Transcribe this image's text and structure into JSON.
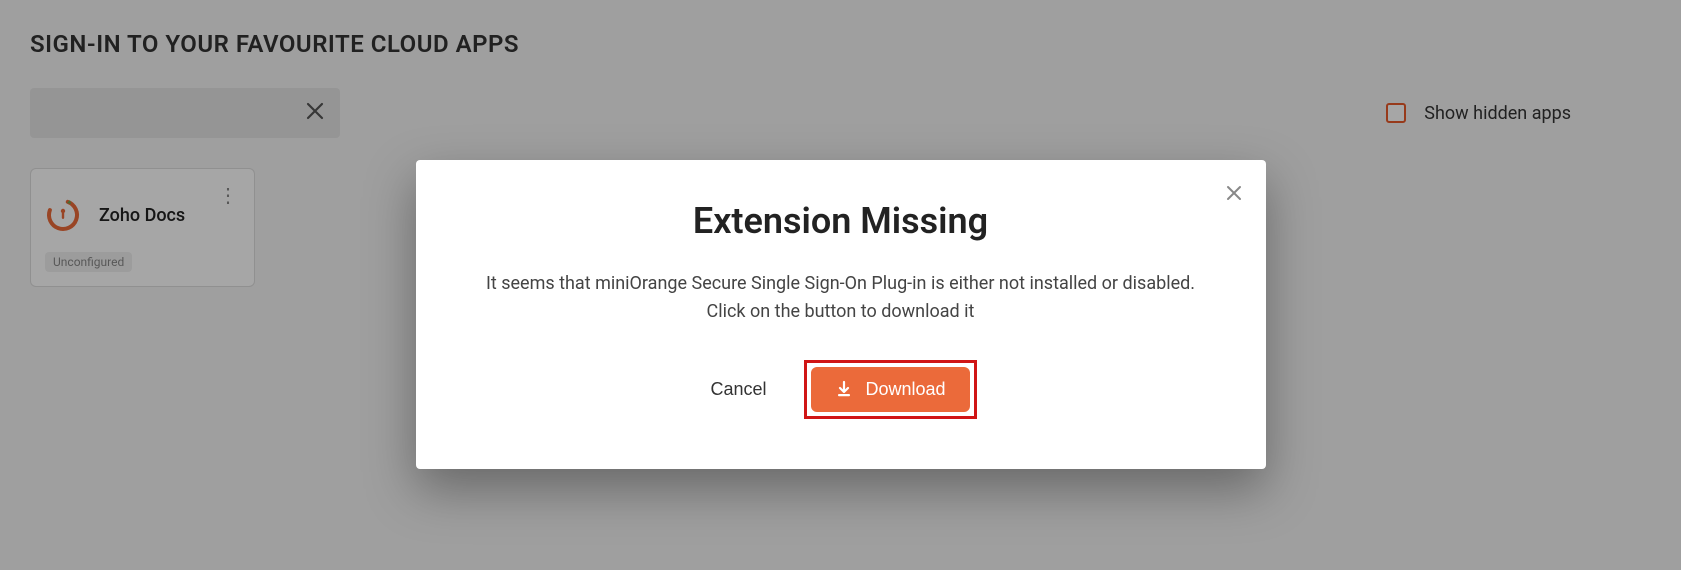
{
  "header": {
    "title": "SIGN-IN TO YOUR FAVOURITE CLOUD APPS"
  },
  "toolbar": {
    "search_value": "",
    "search_placeholder": "",
    "show_hidden_label": "Show hidden apps",
    "show_hidden_checked": false
  },
  "apps": [
    {
      "name": "Zoho Docs",
      "status": "Unconfigured"
    }
  ],
  "modal": {
    "title": "Extension Missing",
    "body_line1": "It seems that miniOrange Secure Single Sign-On Plug-in is either not installed or disabled.",
    "body_line2": "Click on the button to download it",
    "cancel_label": "Cancel",
    "download_label": "Download"
  },
  "colors": {
    "accent": "#eb6a3a",
    "highlight_border": "#d01515"
  }
}
